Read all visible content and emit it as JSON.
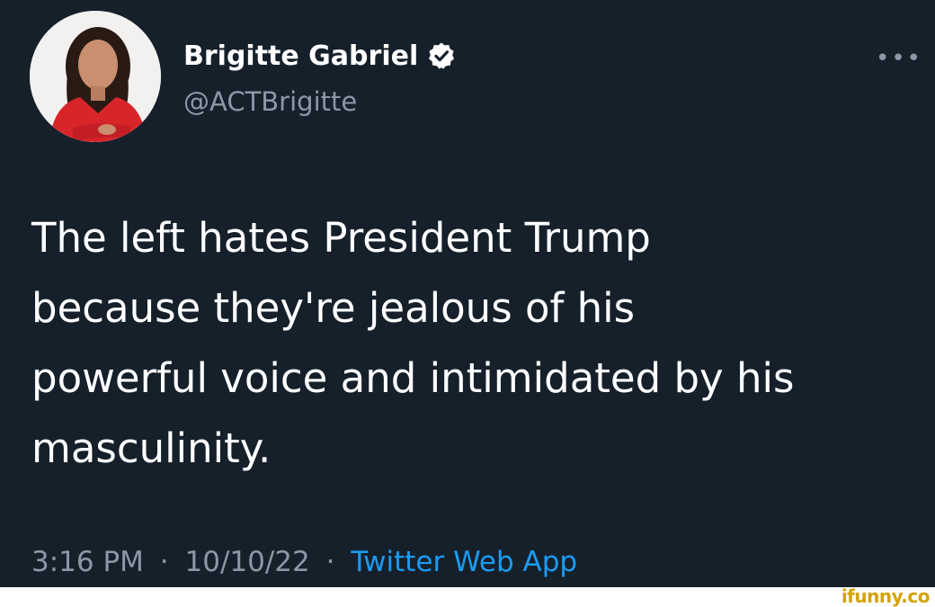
{
  "author": {
    "display_name": "Brigitte Gabriel",
    "handle": "@ACTBrigitte",
    "verified": true
  },
  "icons": {
    "verified": "verified-badge-icon",
    "more": "more-options-icon"
  },
  "more_label": "•••",
  "tweet": {
    "text": "The left hates President Trump\nbecause they're jealous of his\npowerful voice and intimidated by his\nmasculinity.",
    "time": "3:16 PM",
    "separator": "·",
    "date": "10/10/22",
    "source": "Twitter Web App"
  },
  "watermark": "ifunny.co",
  "colors": {
    "background": "#15202b",
    "secondary_text": "#8b98a5",
    "link": "#1d9bf0",
    "watermark": "#d4a300"
  }
}
